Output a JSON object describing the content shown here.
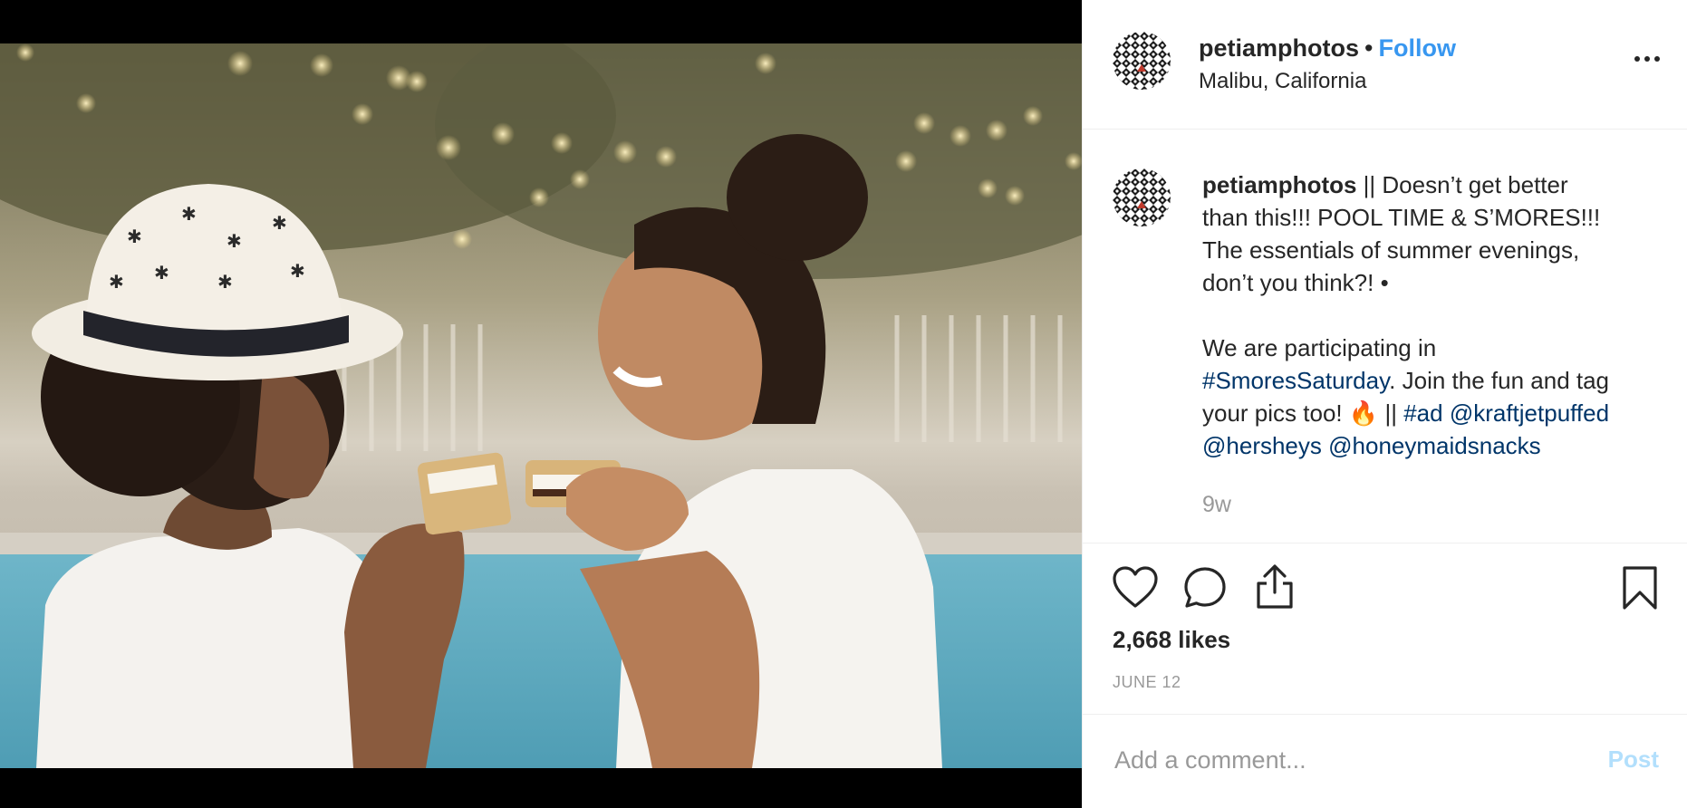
{
  "header": {
    "username": "petiamphotos",
    "separator": "•",
    "follow_label": "Follow",
    "location": "Malibu, California",
    "more_icon": "ellipsis-icon"
  },
  "caption": {
    "username": "petiamphotos",
    "line1_rest": " || Doesn’t get better",
    "line2": "than this!!! POOL TIME & S’MORES!!!",
    "line3": "The essentials of summer evenings,",
    "line4": "don’t you think?! •",
    "line6": "We are participating in",
    "hashtag_smores": "#SmoresSaturday",
    "line7_rest": ". Join the fun and tag",
    "line8_start": "your pics too! 🔥 || ",
    "hashtag_ad": "#ad",
    "mention_kraft": "@kraftjetpuffed",
    "mention_hersheys": "@hersheys",
    "mention_honeymaid": "@honeymaidsnacks",
    "time_ago": "9w"
  },
  "actions": {
    "like_icon": "heart-icon",
    "comment_icon": "comment-bubble-icon",
    "share_icon": "share-icon",
    "save_icon": "bookmark-icon",
    "likes_text": "2,668 likes",
    "date": "JUNE 12"
  },
  "comment": {
    "placeholder": "Add a comment...",
    "post_label": "Post"
  },
  "colors": {
    "link_blue": "#3897f0",
    "hashtag_navy": "#003569",
    "muted_gray": "#999999",
    "post_disabled": "#b2dffc"
  }
}
